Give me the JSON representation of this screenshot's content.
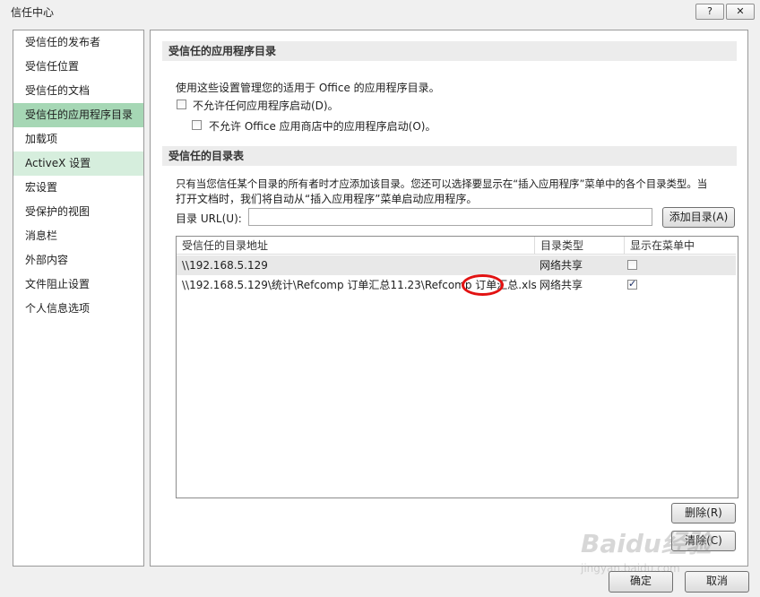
{
  "window": {
    "title": "信任中心",
    "help_label": "?",
    "close_label": "✕"
  },
  "sidebar": {
    "items": [
      {
        "label": "受信任的发布者",
        "state": "normal"
      },
      {
        "label": "受信任位置",
        "state": "normal"
      },
      {
        "label": "受信任的文档",
        "state": "normal"
      },
      {
        "label": "受信任的应用程序目录",
        "state": "selected"
      },
      {
        "label": "加载项",
        "state": "normal"
      },
      {
        "label": "ActiveX 设置",
        "state": "hover"
      },
      {
        "label": "宏设置",
        "state": "normal"
      },
      {
        "label": "受保护的视图",
        "state": "normal"
      },
      {
        "label": "消息栏",
        "state": "normal"
      },
      {
        "label": "外部内容",
        "state": "normal"
      },
      {
        "label": "文件阻止设置",
        "state": "normal"
      },
      {
        "label": "个人信息选项",
        "state": "normal"
      }
    ]
  },
  "section1": {
    "header": "受信任的应用程序目录",
    "description": "使用这些设置管理您的适用于 Office 的应用程序目录。",
    "option1": {
      "label": "不允许任何应用程序启动(D)。",
      "checked": false
    },
    "option2": {
      "label": "不允许 Office 应用商店中的应用程序启动(O)。",
      "checked": false
    }
  },
  "section2": {
    "header": "受信任的目录表",
    "description_line1": "只有当您信任某个目录的所有者时才应添加该目录。您还可以选择要显示在“插入应用程序”菜单中的各个目录类型。当",
    "description_line2": "打开文档时，我们将自动从“插入应用程序”菜单启动应用程序。",
    "url_label": "目录 URL(U):",
    "url_value": "",
    "add_button": "添加目录(A)"
  },
  "catalog_table": {
    "columns": [
      "受信任的目录地址",
      "目录类型",
      "显示在菜单中"
    ],
    "rows": [
      {
        "address": "\\\\192.168.5.129",
        "type": "网络共享",
        "show_in_menu": false
      },
      {
        "address": "\\\\192.168.5.129\\统计\\Refcomp 订单汇总11.23\\Refcomp 订单汇总.xls",
        "type": "网络共享",
        "show_in_menu": true
      }
    ]
  },
  "actions": {
    "remove_button": "删除(R)",
    "clear_button": "清除(C)"
  },
  "footer": {
    "ok_button": "确定",
    "cancel_button": "取消"
  },
  "watermark": {
    "main": "Baidu经验",
    "sub": "jingyan.baidu.com"
  },
  "colors": {
    "selected_item": "#a6d7b5",
    "hover_item": "#d6eedd",
    "annotation": "#e21212"
  }
}
